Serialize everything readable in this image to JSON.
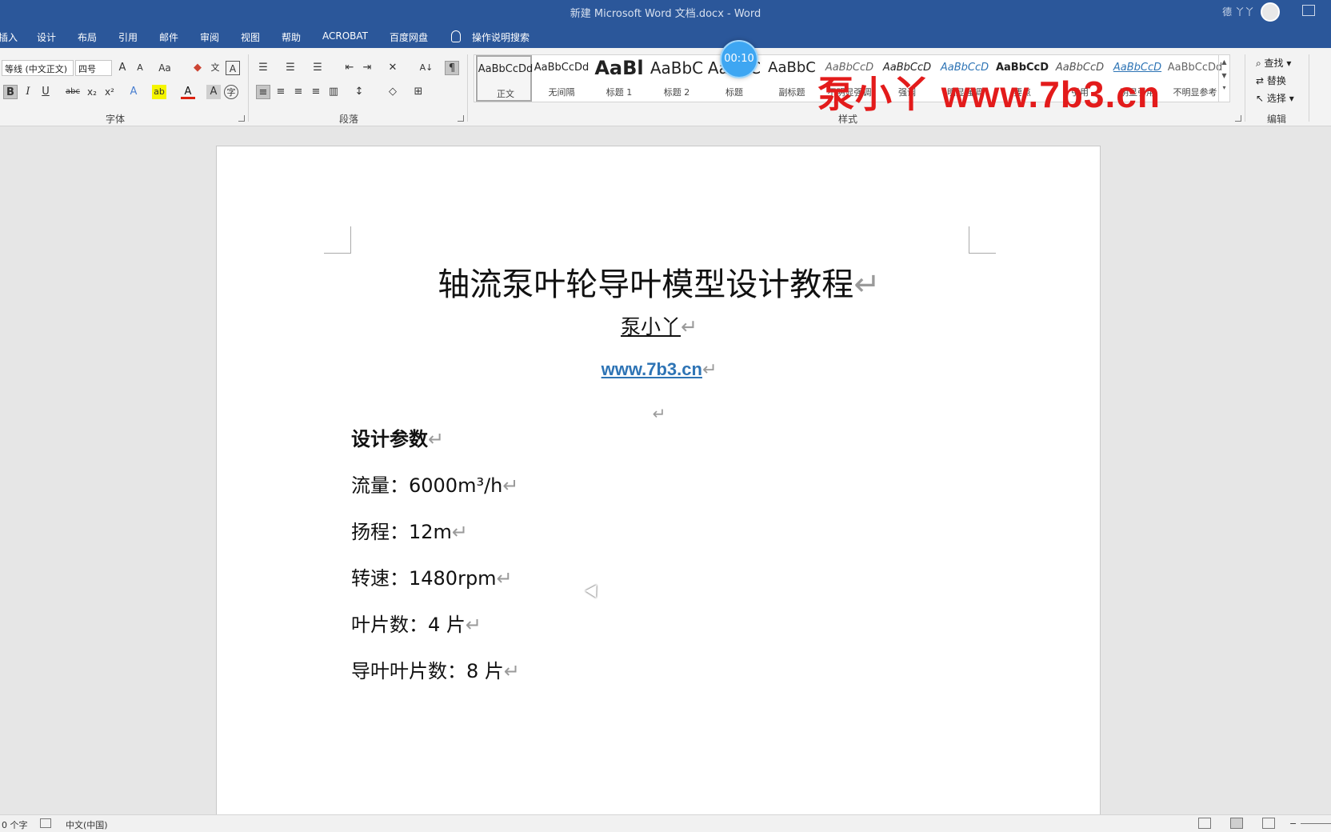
{
  "titlebar": {
    "title": "新建 Microsoft Word 文档.docx  -  Word",
    "user": "德 丫丫"
  },
  "menu": {
    "tabs": [
      "插入",
      "设计",
      "布局",
      "引用",
      "邮件",
      "审阅",
      "视图",
      "帮助",
      "ACROBAT",
      "百度网盘"
    ],
    "tell_me": "操作说明搜索"
  },
  "ribbon": {
    "font": {
      "name": "等线 (中文正文)",
      "size": "四号",
      "group_label": "字体"
    },
    "paragraph": {
      "group_label": "段落"
    },
    "styles": {
      "group_label": "样式",
      "items": [
        {
          "sample": "AaBbCcDd",
          "name": "正文"
        },
        {
          "sample": "AaBbCcDd",
          "name": "无间隔"
        },
        {
          "sample": "AaBl",
          "name": "标题 1"
        },
        {
          "sample": "AaBbC",
          "name": "标题 2"
        },
        {
          "sample": "AaBbC",
          "name": "标题"
        },
        {
          "sample": "AaBbC",
          "name": "副标题"
        },
        {
          "sample": "AaBbCcD",
          "name": "不明显强调"
        },
        {
          "sample": "AaBbCcD",
          "name": "强调"
        },
        {
          "sample": "AaBbCcD",
          "name": "明显强调"
        },
        {
          "sample": "AaBbCcD",
          "name": "要点"
        },
        {
          "sample": "AaBbCcD",
          "name": "引用"
        },
        {
          "sample": "AaBbCcD",
          "name": "明显引用"
        },
        {
          "sample": "AaBbCcDd",
          "name": "不明显参考"
        }
      ]
    },
    "editing": {
      "group_label": "编辑",
      "find": "查找",
      "replace": "替换",
      "select": "选择"
    }
  },
  "overlay": {
    "watermark": "泵小丫  www.7b3.cn",
    "timer": "00:10"
  },
  "document": {
    "title": "轴流泵叶轮导叶模型设计教程",
    "author": "泵小丫",
    "link": "www.7b3.cn",
    "heading": "设计参数",
    "params": [
      "流量：6000m³/h",
      "扬程：12m",
      "转速：1480rpm",
      "叶片数：4 片",
      "导叶叶片数：8 片"
    ],
    "para_mark": "↵"
  },
  "statusbar": {
    "word_count": "0 个字",
    "language": "中文(中国)"
  }
}
